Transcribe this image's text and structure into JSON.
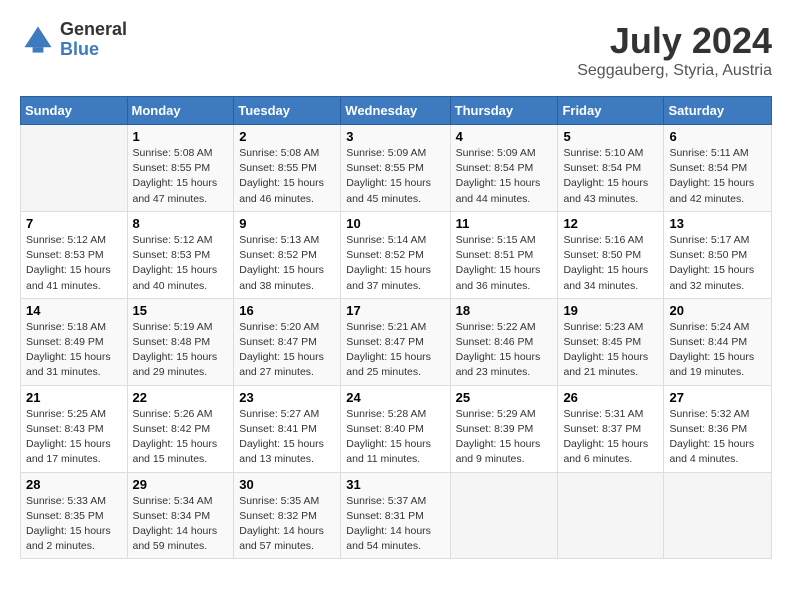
{
  "header": {
    "logo_line1": "General",
    "logo_line2": "Blue",
    "month_year": "July 2024",
    "location": "Seggauberg, Styria, Austria"
  },
  "weekdays": [
    "Sunday",
    "Monday",
    "Tuesday",
    "Wednesday",
    "Thursday",
    "Friday",
    "Saturday"
  ],
  "weeks": [
    [
      {
        "day": "",
        "sunrise": "",
        "sunset": "",
        "daylight": "",
        "empty": true
      },
      {
        "day": "1",
        "sunrise": "5:08 AM",
        "sunset": "8:55 PM",
        "daylight": "15 hours and 47 minutes."
      },
      {
        "day": "2",
        "sunrise": "5:08 AM",
        "sunset": "8:55 PM",
        "daylight": "15 hours and 46 minutes."
      },
      {
        "day": "3",
        "sunrise": "5:09 AM",
        "sunset": "8:55 PM",
        "daylight": "15 hours and 45 minutes."
      },
      {
        "day": "4",
        "sunrise": "5:09 AM",
        "sunset": "8:54 PM",
        "daylight": "15 hours and 44 minutes."
      },
      {
        "day": "5",
        "sunrise": "5:10 AM",
        "sunset": "8:54 PM",
        "daylight": "15 hours and 43 minutes."
      },
      {
        "day": "6",
        "sunrise": "5:11 AM",
        "sunset": "8:54 PM",
        "daylight": "15 hours and 42 minutes."
      }
    ],
    [
      {
        "day": "7",
        "sunrise": "5:12 AM",
        "sunset": "8:53 PM",
        "daylight": "15 hours and 41 minutes."
      },
      {
        "day": "8",
        "sunrise": "5:12 AM",
        "sunset": "8:53 PM",
        "daylight": "15 hours and 40 minutes."
      },
      {
        "day": "9",
        "sunrise": "5:13 AM",
        "sunset": "8:52 PM",
        "daylight": "15 hours and 38 minutes."
      },
      {
        "day": "10",
        "sunrise": "5:14 AM",
        "sunset": "8:52 PM",
        "daylight": "15 hours and 37 minutes."
      },
      {
        "day": "11",
        "sunrise": "5:15 AM",
        "sunset": "8:51 PM",
        "daylight": "15 hours and 36 minutes."
      },
      {
        "day": "12",
        "sunrise": "5:16 AM",
        "sunset": "8:50 PM",
        "daylight": "15 hours and 34 minutes."
      },
      {
        "day": "13",
        "sunrise": "5:17 AM",
        "sunset": "8:50 PM",
        "daylight": "15 hours and 32 minutes."
      }
    ],
    [
      {
        "day": "14",
        "sunrise": "5:18 AM",
        "sunset": "8:49 PM",
        "daylight": "15 hours and 31 minutes."
      },
      {
        "day": "15",
        "sunrise": "5:19 AM",
        "sunset": "8:48 PM",
        "daylight": "15 hours and 29 minutes."
      },
      {
        "day": "16",
        "sunrise": "5:20 AM",
        "sunset": "8:47 PM",
        "daylight": "15 hours and 27 minutes."
      },
      {
        "day": "17",
        "sunrise": "5:21 AM",
        "sunset": "8:47 PM",
        "daylight": "15 hours and 25 minutes."
      },
      {
        "day": "18",
        "sunrise": "5:22 AM",
        "sunset": "8:46 PM",
        "daylight": "15 hours and 23 minutes."
      },
      {
        "day": "19",
        "sunrise": "5:23 AM",
        "sunset": "8:45 PM",
        "daylight": "15 hours and 21 minutes."
      },
      {
        "day": "20",
        "sunrise": "5:24 AM",
        "sunset": "8:44 PM",
        "daylight": "15 hours and 19 minutes."
      }
    ],
    [
      {
        "day": "21",
        "sunrise": "5:25 AM",
        "sunset": "8:43 PM",
        "daylight": "15 hours and 17 minutes."
      },
      {
        "day": "22",
        "sunrise": "5:26 AM",
        "sunset": "8:42 PM",
        "daylight": "15 hours and 15 minutes."
      },
      {
        "day": "23",
        "sunrise": "5:27 AM",
        "sunset": "8:41 PM",
        "daylight": "15 hours and 13 minutes."
      },
      {
        "day": "24",
        "sunrise": "5:28 AM",
        "sunset": "8:40 PM",
        "daylight": "15 hours and 11 minutes."
      },
      {
        "day": "25",
        "sunrise": "5:29 AM",
        "sunset": "8:39 PM",
        "daylight": "15 hours and 9 minutes."
      },
      {
        "day": "26",
        "sunrise": "5:31 AM",
        "sunset": "8:37 PM",
        "daylight": "15 hours and 6 minutes."
      },
      {
        "day": "27",
        "sunrise": "5:32 AM",
        "sunset": "8:36 PM",
        "daylight": "15 hours and 4 minutes."
      }
    ],
    [
      {
        "day": "28",
        "sunrise": "5:33 AM",
        "sunset": "8:35 PM",
        "daylight": "15 hours and 2 minutes."
      },
      {
        "day": "29",
        "sunrise": "5:34 AM",
        "sunset": "8:34 PM",
        "daylight": "14 hours and 59 minutes."
      },
      {
        "day": "30",
        "sunrise": "5:35 AM",
        "sunset": "8:32 PM",
        "daylight": "14 hours and 57 minutes."
      },
      {
        "day": "31",
        "sunrise": "5:37 AM",
        "sunset": "8:31 PM",
        "daylight": "14 hours and 54 minutes."
      },
      {
        "day": "",
        "sunrise": "",
        "sunset": "",
        "daylight": "",
        "empty": true
      },
      {
        "day": "",
        "sunrise": "",
        "sunset": "",
        "daylight": "",
        "empty": true
      },
      {
        "day": "",
        "sunrise": "",
        "sunset": "",
        "daylight": "",
        "empty": true
      }
    ]
  ]
}
